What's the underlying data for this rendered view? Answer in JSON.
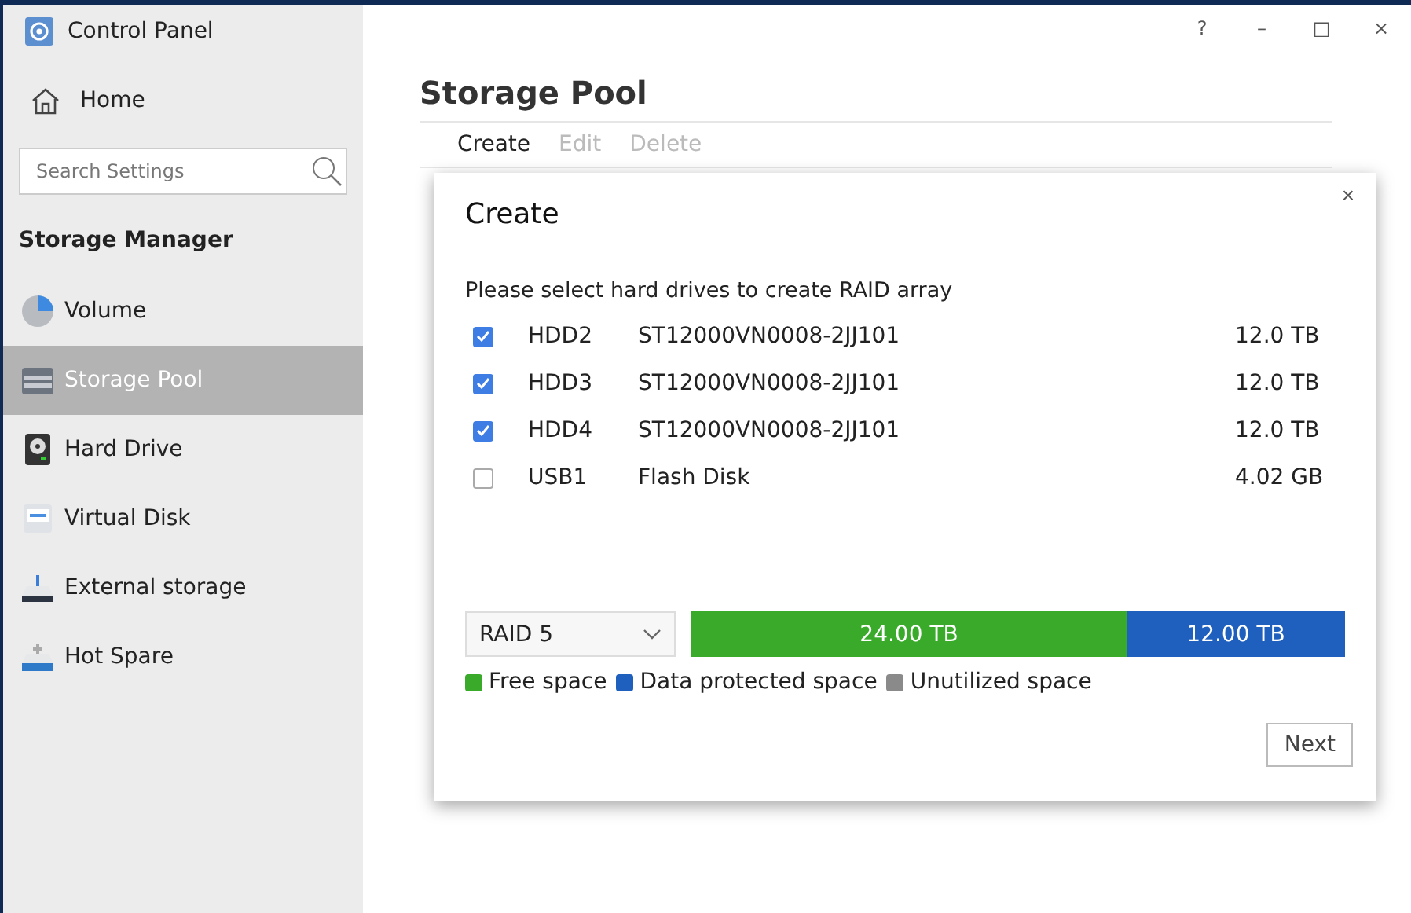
{
  "sidebar": {
    "app_title": "Control Panel",
    "home": "Home",
    "search": {
      "placeholder": "Search Settings"
    },
    "section": "Storage Manager",
    "items": [
      {
        "label": "Volume",
        "selected": false
      },
      {
        "label": "Storage Pool",
        "selected": true
      },
      {
        "label": "Hard Drive",
        "selected": false
      },
      {
        "label": "Virtual Disk",
        "selected": false
      },
      {
        "label": "External storage",
        "selected": false
      },
      {
        "label": "Hot Spare",
        "selected": false
      }
    ]
  },
  "window_controls": [
    "?",
    "–",
    "□",
    "×"
  ],
  "page": {
    "title": "Storage Pool",
    "toolbar": [
      {
        "label": "Create",
        "disabled": false
      },
      {
        "label": "Edit",
        "disabled": true
      },
      {
        "label": "Delete",
        "disabled": true
      }
    ]
  },
  "dialog": {
    "title": "Create",
    "close": "×",
    "prompt": "Please select hard drives to create RAID array",
    "drives": [
      {
        "name": "HDD2",
        "model": "ST12000VN0008-2JJ101",
        "size": "12.0 TB",
        "checked": true
      },
      {
        "name": "HDD3",
        "model": "ST12000VN0008-2JJ101",
        "size": "12.0 TB",
        "checked": true
      },
      {
        "name": "HDD4",
        "model": "ST12000VN0008-2JJ101",
        "size": "12.0 TB",
        "checked": true
      },
      {
        "name": "USB1",
        "model": "Flash Disk",
        "size": "4.02 GB",
        "checked": false
      }
    ],
    "raid_select": {
      "value": "RAID 5"
    },
    "capacity": [
      {
        "label": "24.00 TB",
        "level": 0.666,
        "color": "#3aaa2a"
      },
      {
        "label": "12.00 TB",
        "level": 0.334,
        "color": "#1f5fbd"
      }
    ],
    "legend": [
      {
        "label": "Free space",
        "color": "#3aaa2a"
      },
      {
        "label": "Data protected space",
        "color": "#1f5fbd"
      },
      {
        "label": "Unutilized space",
        "color": "#8a8a8a"
      }
    ],
    "next": "Next"
  }
}
